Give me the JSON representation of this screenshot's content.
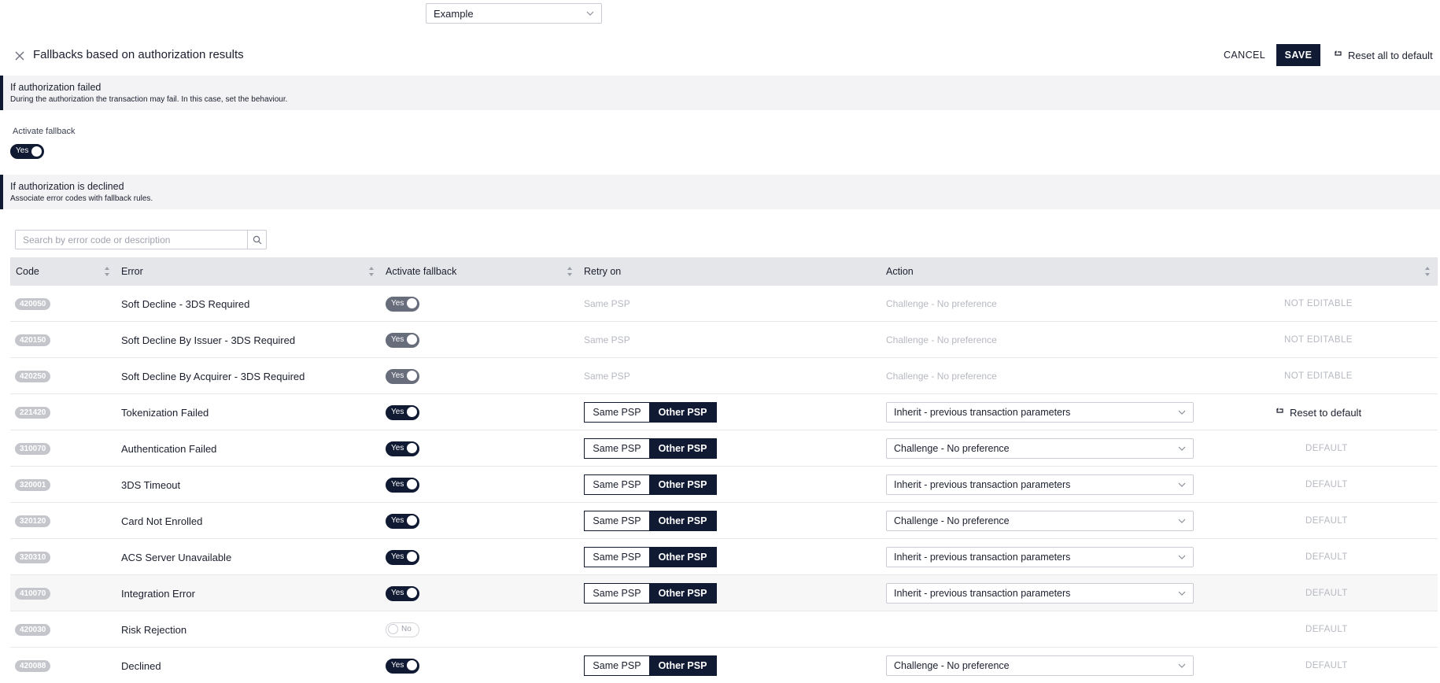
{
  "top_select": {
    "value": "Example"
  },
  "header": {
    "title": "Fallbacks based on authorization results",
    "cancel_label": "CANCEL",
    "save_label": "SAVE",
    "reset_all_label": "Reset all to default"
  },
  "section_failed": {
    "title": "If authorization failed",
    "description": "During the authorization the transaction may fail. In this case, set the behaviour."
  },
  "activate_fallback": {
    "label": "Activate fallback",
    "toggle_label": "Yes"
  },
  "section_declined": {
    "title": "If authorization is declined",
    "description": "Associate error codes with fallback rules."
  },
  "search": {
    "placeholder": "Search by error code or description"
  },
  "table": {
    "columns": [
      "Code",
      "Error",
      "Activate fallback",
      "Retry on",
      "Action"
    ],
    "rows": [
      {
        "code": "420050",
        "error": "Soft Decline - 3DS Required",
        "toggle": "Yes",
        "retry": "Same PSP",
        "action": "Challenge - No preference",
        "status": "NOT EDITABLE"
      },
      {
        "code": "420150",
        "error": "Soft Decline By Issuer - 3DS Required",
        "toggle": "Yes",
        "retry": "Same PSP",
        "action": "Challenge - No preference",
        "status": "NOT EDITABLE"
      },
      {
        "code": "420250",
        "error": "Soft Decline By Acquirer - 3DS Required",
        "toggle": "Yes",
        "retry": "Same PSP",
        "action": "Challenge - No preference",
        "status": "NOT EDITABLE"
      },
      {
        "code": "221420",
        "error": "Tokenization Failed",
        "toggle": "Yes",
        "retry_a": "Same PSP",
        "retry_b": "Other PSP",
        "action": "Inherit - previous transaction parameters",
        "status": "Reset to default"
      },
      {
        "code": "310070",
        "error": "Authentication Failed",
        "toggle": "Yes",
        "retry_a": "Same PSP",
        "retry_b": "Other PSP",
        "action": "Challenge - No preference",
        "status": "DEFAULT"
      },
      {
        "code": "320001",
        "error": "3DS Timeout",
        "toggle": "Yes",
        "retry_a": "Same PSP",
        "retry_b": "Other PSP",
        "action": "Inherit - previous transaction parameters",
        "status": "DEFAULT"
      },
      {
        "code": "320120",
        "error": "Card Not Enrolled",
        "toggle": "Yes",
        "retry_a": "Same PSP",
        "retry_b": "Other PSP",
        "action": "Challenge - No preference",
        "status": "DEFAULT"
      },
      {
        "code": "320310",
        "error": "ACS Server Unavailable",
        "toggle": "Yes",
        "retry_a": "Same PSP",
        "retry_b": "Other PSP",
        "action": "Inherit - previous transaction parameters",
        "status": "DEFAULT"
      },
      {
        "code": "410070",
        "error": "Integration Error",
        "toggle": "Yes",
        "retry_a": "Same PSP",
        "retry_b": "Other PSP",
        "action": "Inherit - previous transaction parameters",
        "status": "DEFAULT"
      },
      {
        "code": "420030",
        "error": "Risk Rejection",
        "toggle": "No",
        "status": "DEFAULT"
      },
      {
        "code": "420088",
        "error": "Declined",
        "toggle": "Yes",
        "retry_a": "Same PSP",
        "retry_b": "Other PSP",
        "action": "Challenge - No preference",
        "status": "DEFAULT"
      }
    ]
  },
  "colors": {
    "primary": "#101a33",
    "muted": "#b6b9c1",
    "header_bg": "#e5e6e9",
    "section_bg": "#f3f3f5"
  }
}
